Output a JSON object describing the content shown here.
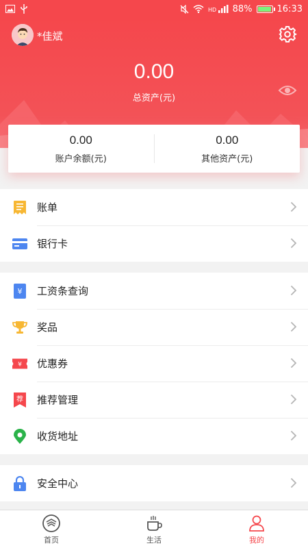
{
  "status_bar": {
    "battery": "88%",
    "time": "16:33",
    "battery_level": 0.88
  },
  "header": {
    "username": "*佳斌",
    "total_value": "0.00",
    "total_label": "总资产(元)"
  },
  "card": {
    "left_value": "0.00",
    "left_label": "账户余额(元)",
    "right_value": "0.00",
    "right_label": "其他资产(元)"
  },
  "menu": {
    "bill": "账单",
    "bank_card": "银行卡",
    "salary_query": "工资条查询",
    "prizes": "奖品",
    "coupons": "优惠券",
    "referral": "推荐管理",
    "address": "收货地址",
    "security": "安全中心"
  },
  "icons": {
    "coupon_glyph": "¥",
    "salary_glyph": "¥",
    "referral_glyph": "荐"
  },
  "nav": {
    "home": "首页",
    "life": "生活",
    "mine": "我的"
  },
  "colors": {
    "brand_red": "#f5474c",
    "card_blue": "#4d86f0",
    "bill_orange": "#f7b733",
    "location_green": "#2bb34a"
  }
}
